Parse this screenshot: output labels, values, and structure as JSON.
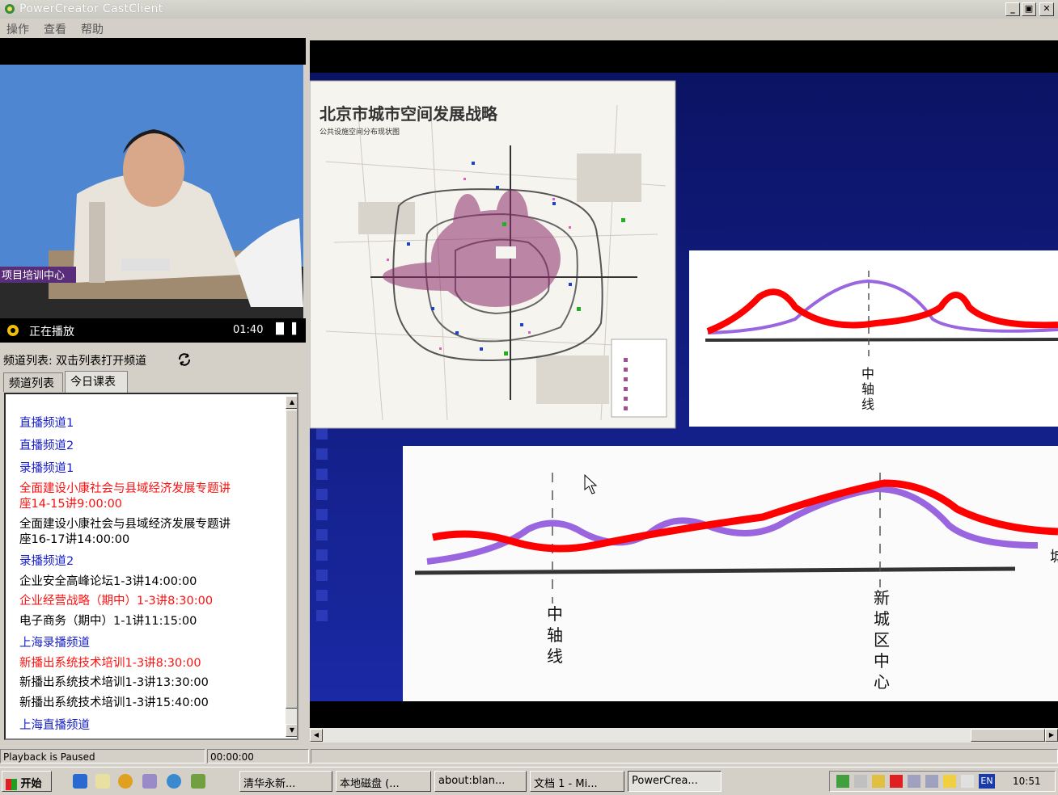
{
  "window": {
    "title": "PowerCreator CastClient",
    "minimize": "_",
    "restore": "▣",
    "close": "✕"
  },
  "menu": [
    "操作",
    "查看",
    "帮助"
  ],
  "video": {
    "caption": "项目培训中心"
  },
  "player": {
    "status": "正在播放",
    "time": "01:40"
  },
  "channels": {
    "header": "频道列表:  双击列表打开频道",
    "tabs": [
      "频道列表",
      "今日课表"
    ],
    "items": [
      {
        "text": "直播频道1",
        "color": "blue"
      },
      {
        "text": "直播频道2",
        "color": "blue"
      },
      {
        "text": "录播频道1",
        "color": "blue"
      },
      {
        "text": "全面建设小康社会与县域经济发展专题讲",
        "color": "red"
      },
      {
        "text": "座14-15讲9:00:00",
        "color": "red"
      },
      {
        "text": "全面建设小康社会与县域经济发展专题讲",
        "color": "black"
      },
      {
        "text": "座16-17讲14:00:00",
        "color": "black"
      },
      {
        "text": "录播频道2",
        "color": "blue"
      },
      {
        "text": "企业安全高峰论坛1-3讲14:00:00",
        "color": "black"
      },
      {
        "text": "企业经营战略（期中）1-3讲8:30:00",
        "color": "red"
      },
      {
        "text": "电子商务（期中）1-1讲11:15:00",
        "color": "black"
      },
      {
        "text": "上海录播频道",
        "color": "blue"
      },
      {
        "text": "新播出系统技术培训1-3讲8:30:00",
        "color": "red"
      },
      {
        "text": "新播出系统技术培训1-3讲13:30:00",
        "color": "black"
      },
      {
        "text": "新播出系统技术培训1-3讲15:40:00",
        "color": "black"
      },
      {
        "text": "上海直播频道",
        "color": "blue"
      }
    ]
  },
  "slide": {
    "map_title": "北京市城市空间发展战略",
    "map_subtitle": "公共设施空间分布现状图",
    "top_label": "中轴线",
    "bottom_label_left": "中轴线",
    "bottom_label_right": "新城区中心",
    "edge_char": "城"
  },
  "statusbar": {
    "message": "Playback is Paused",
    "time": "00:00:00"
  },
  "taskbar": {
    "start": "开始",
    "tasks": [
      "清华永新...",
      "本地磁盘 (...",
      "about:blan...",
      "文档 1 - Mi...",
      "PowerCrea..."
    ],
    "lang": "EN",
    "clock": "10:51"
  },
  "colors": {
    "link_blue": "#1a20c8",
    "live_red": "#ff1010",
    "slide_blue": "#0b1a8a",
    "curve_red": "#ff0000",
    "curve_purple": "#9a66e0"
  }
}
